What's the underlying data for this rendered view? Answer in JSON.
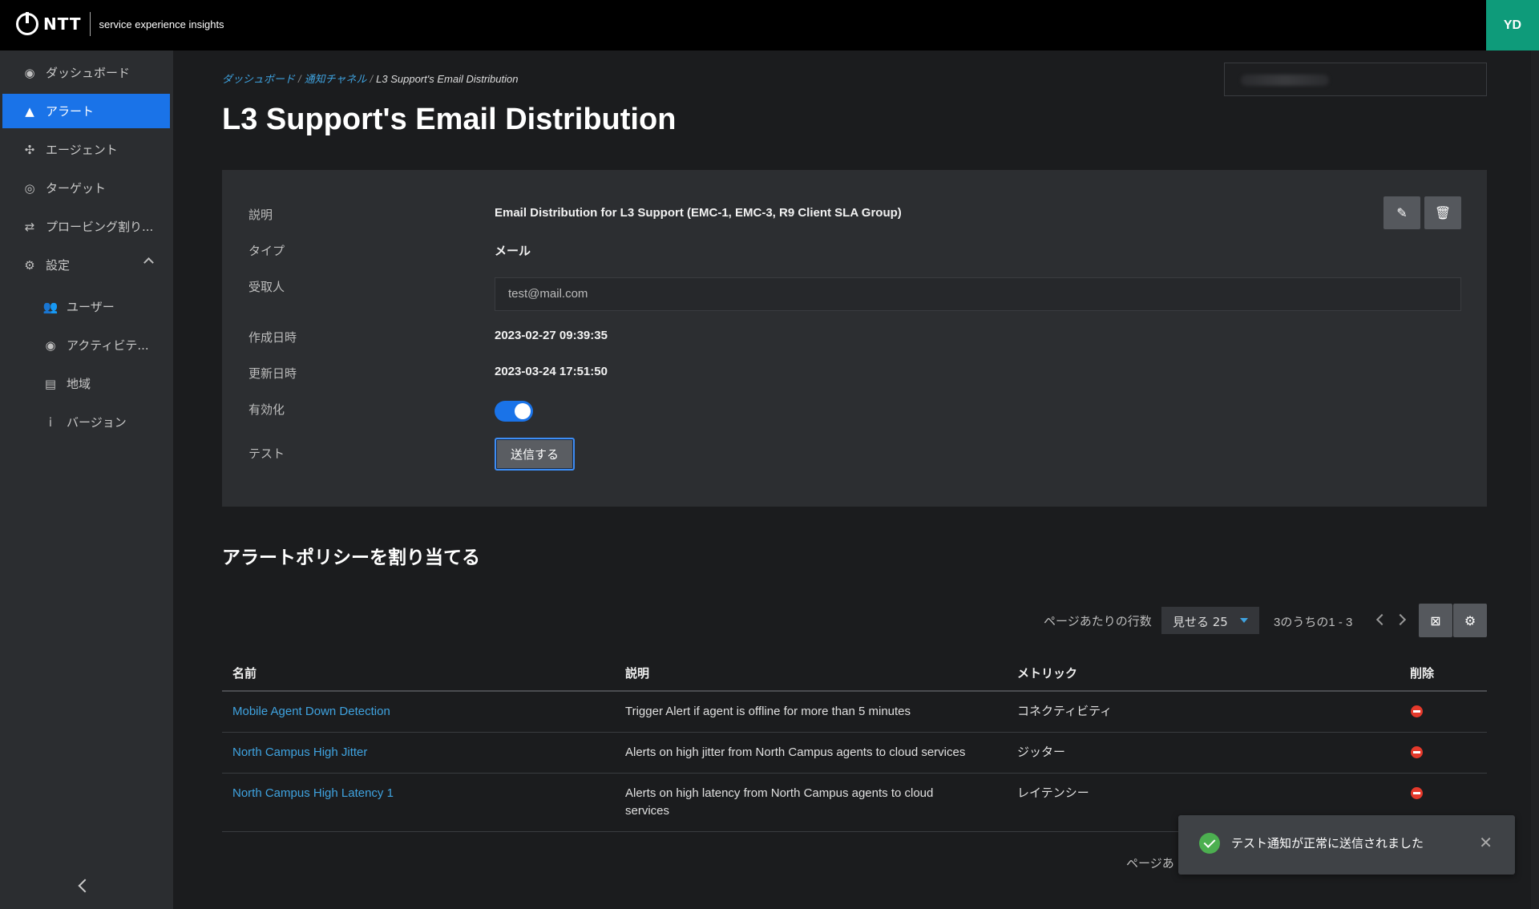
{
  "header": {
    "logo_text": "NTT",
    "product": "service experience insights",
    "avatar": "YD"
  },
  "sidebar": {
    "items": [
      {
        "label": "ダッシュボード",
        "icon": "dashboard-icon"
      },
      {
        "label": "アラート",
        "icon": "alert-icon",
        "active": true
      },
      {
        "label": "エージェント",
        "icon": "agent-icon"
      },
      {
        "label": "ターゲット",
        "icon": "target-icon"
      },
      {
        "label": "プロービング割り...",
        "icon": "swap-icon"
      },
      {
        "label": "設定",
        "icon": "gear-icon"
      }
    ],
    "sub_items": [
      {
        "label": "ユーザー",
        "icon": "users-icon"
      },
      {
        "label": "アクティビテ...",
        "icon": "eye-icon"
      },
      {
        "label": "地域",
        "icon": "id-card-icon"
      },
      {
        "label": "バージョン",
        "icon": "info-icon"
      }
    ]
  },
  "breadcrumb": [
    "ダッシュボード",
    "通知チャネル",
    "L3 Support's Email Distribution"
  ],
  "page_title": "L3 Support's Email Distribution",
  "details": {
    "description_label": "説明",
    "description": "Email Distribution for L3 Support (EMC-1, EMC-3, R9 Client SLA Group)",
    "type_label": "タイプ",
    "type": "メール",
    "recipient_label": "受取人",
    "recipient": "test@mail.com",
    "created_label": "作成日時",
    "created": "2023-02-27 09:39:35",
    "updated_label": "更新日時",
    "updated": "2023-03-24 17:51:50",
    "enabled_label": "有効化",
    "enabled": true,
    "test_label": "テスト",
    "send_button": "送信する"
  },
  "policies": {
    "title": "アラートポリシーを割り当てる",
    "rows_per_page_label": "ページあたりの行数",
    "rows_per_page": "見せる 25",
    "range": "3のうちの1 - 3",
    "columns": [
      "名前",
      "説明",
      "メトリック",
      "削除"
    ],
    "rows": [
      {
        "name": "Mobile Agent Down Detection",
        "description": "Trigger Alert if agent is offline for more than 5 minutes",
        "metric": "コネクティビティ"
      },
      {
        "name": "North Campus High Jitter",
        "description": "Alerts on high jitter from North Campus agents to cloud services",
        "metric": "ジッター"
      },
      {
        "name": "North Campus High Latency 1",
        "description": "Alerts on high latency from North Campus agents to cloud services",
        "metric": "レイテンシー"
      }
    ],
    "footer_label": "ページあ"
  },
  "toast": {
    "message": "テスト通知が正常に送信されました"
  }
}
